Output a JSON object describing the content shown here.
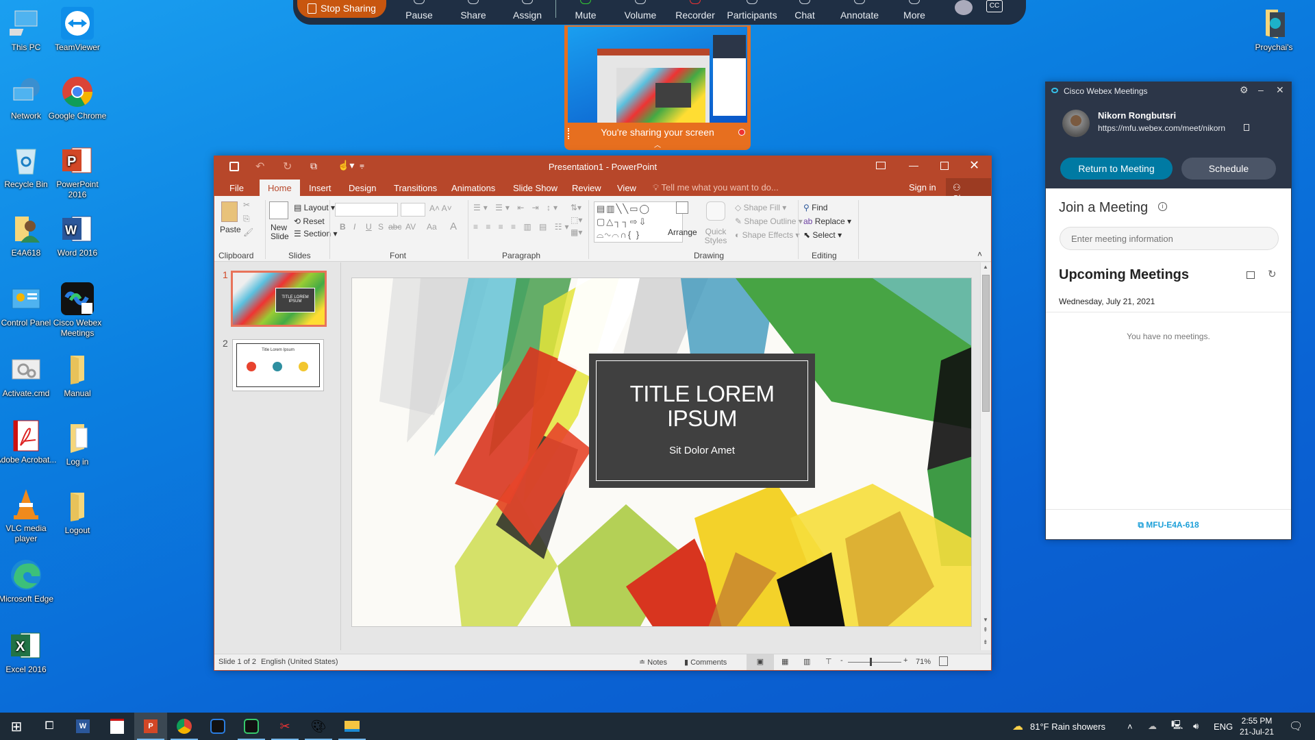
{
  "desktop": {
    "icons_left": [
      {
        "label": "This PC",
        "icon": "this-pc-icon"
      },
      {
        "label": "TeamViewer",
        "icon": "teamviewer-icon"
      },
      {
        "label": "Network",
        "icon": "network-icon"
      },
      {
        "label": "Google Chrome",
        "icon": "chrome-icon"
      },
      {
        "label": "Recycle Bin",
        "icon": "recycle-bin-icon"
      },
      {
        "label": "PowerPoint 2016",
        "icon": "powerpoint-icon"
      },
      {
        "label": "E4A618",
        "icon": "user-folder-icon"
      },
      {
        "label": "Word 2016",
        "icon": "word-icon"
      },
      {
        "label": "Control Panel",
        "icon": "control-panel-icon"
      },
      {
        "label": "Cisco Webex Meetings",
        "icon": "webex-icon"
      },
      {
        "label": "Activate.cmd",
        "icon": "cmd-file-icon"
      },
      {
        "label": "Manual",
        "icon": "folder-icon"
      },
      {
        "label": "Adobe Acrobat...",
        "icon": "acrobat-icon"
      },
      {
        "label": "Log in",
        "icon": "folder-icon"
      },
      {
        "label": "VLC media player",
        "icon": "vlc-icon"
      },
      {
        "label": "Logout",
        "icon": "folder-icon"
      },
      {
        "label": "Microsoft Edge",
        "icon": "edge-icon"
      },
      {
        "label": "Excel 2016",
        "icon": "excel-icon"
      }
    ],
    "icon_right": {
      "label": "Proychai's",
      "icon": "folder-icon"
    }
  },
  "share_toolbar": {
    "stop_sharing": "Stop Sharing",
    "buttons": [
      "Pause",
      "Share",
      "Assign",
      "Mute",
      "Volume",
      "Recorder",
      "Participants",
      "Chat",
      "Annotate",
      "More"
    ],
    "cc_label": "CC"
  },
  "share_preview": {
    "message": "You're sharing your screen"
  },
  "powerpoint": {
    "title": "Presentation1 - PowerPoint",
    "tabs": [
      "File",
      "Home",
      "Insert",
      "Design",
      "Transitions",
      "Animations",
      "Slide Show",
      "Review",
      "View"
    ],
    "active_tab": "Home",
    "tell_me": "Tell me what you want to do...",
    "sign_in": "Sign in",
    "share": "Share",
    "ribbon": {
      "clipboard": {
        "label": "Clipboard",
        "paste": "Paste"
      },
      "slides": {
        "label": "Slides",
        "new_slide": "New Slide",
        "layout": "Layout",
        "reset": "Reset",
        "section": "Section"
      },
      "font": {
        "label": "Font",
        "bold": "B",
        "italic": "I",
        "underline": "U",
        "shadow": "S",
        "strike": "abc",
        "spacing": "AV",
        "case": "Aa",
        "color": "A"
      },
      "paragraph": {
        "label": "Paragraph"
      },
      "drawing": {
        "label": "Drawing",
        "arrange": "Arrange",
        "quick_styles": "Quick Styles",
        "shape_fill": "Shape Fill",
        "shape_outline": "Shape Outline",
        "shape_effects": "Shape Effects"
      },
      "editing": {
        "label": "Editing",
        "find": "Find",
        "replace": "Replace",
        "select": "Select"
      }
    },
    "thumbnails": [
      {
        "number": "1",
        "title": "TITLE LOREM IPSUM",
        "selected": true
      },
      {
        "number": "2",
        "title": "Title Lorem Ipsum",
        "selected": false
      }
    ],
    "slide": {
      "title_line1": "TITLE LOREM",
      "title_line2": "IPSUM",
      "subtitle": "Sit Dolor Amet"
    },
    "status": {
      "slide_info": "Slide 1 of 2",
      "language": "English (United States)",
      "notes": "Notes",
      "comments": "Comments",
      "zoom": "71%"
    }
  },
  "webex": {
    "app_title": "Cisco Webex Meetings",
    "user_name": "Nikorn Rongbutsri",
    "meeting_url": "https://mfu.webex.com/meet/nikorn",
    "return_button": "Return to Meeting",
    "schedule_button": "Schedule",
    "join_heading": "Join a Meeting",
    "join_placeholder": "Enter meeting information",
    "upcoming_heading": "Upcoming Meetings",
    "date": "Wednesday, July 21, 2021",
    "no_meetings": "You have no meetings.",
    "device": "MFU-E4A-618",
    "accent": "#007aa3"
  },
  "taskbar": {
    "apps": [
      "Start",
      "Task View",
      "Word",
      "Acrobat",
      "PowerPoint",
      "Chrome",
      "Webex",
      "Webex Meetings",
      "Snipping Tool",
      "Paint",
      "File Explorer"
    ],
    "weather_temp": "81°F",
    "weather_text": "Rain showers",
    "language": "ENG",
    "time": "2:55 PM",
    "date": "21-Jul-21"
  }
}
